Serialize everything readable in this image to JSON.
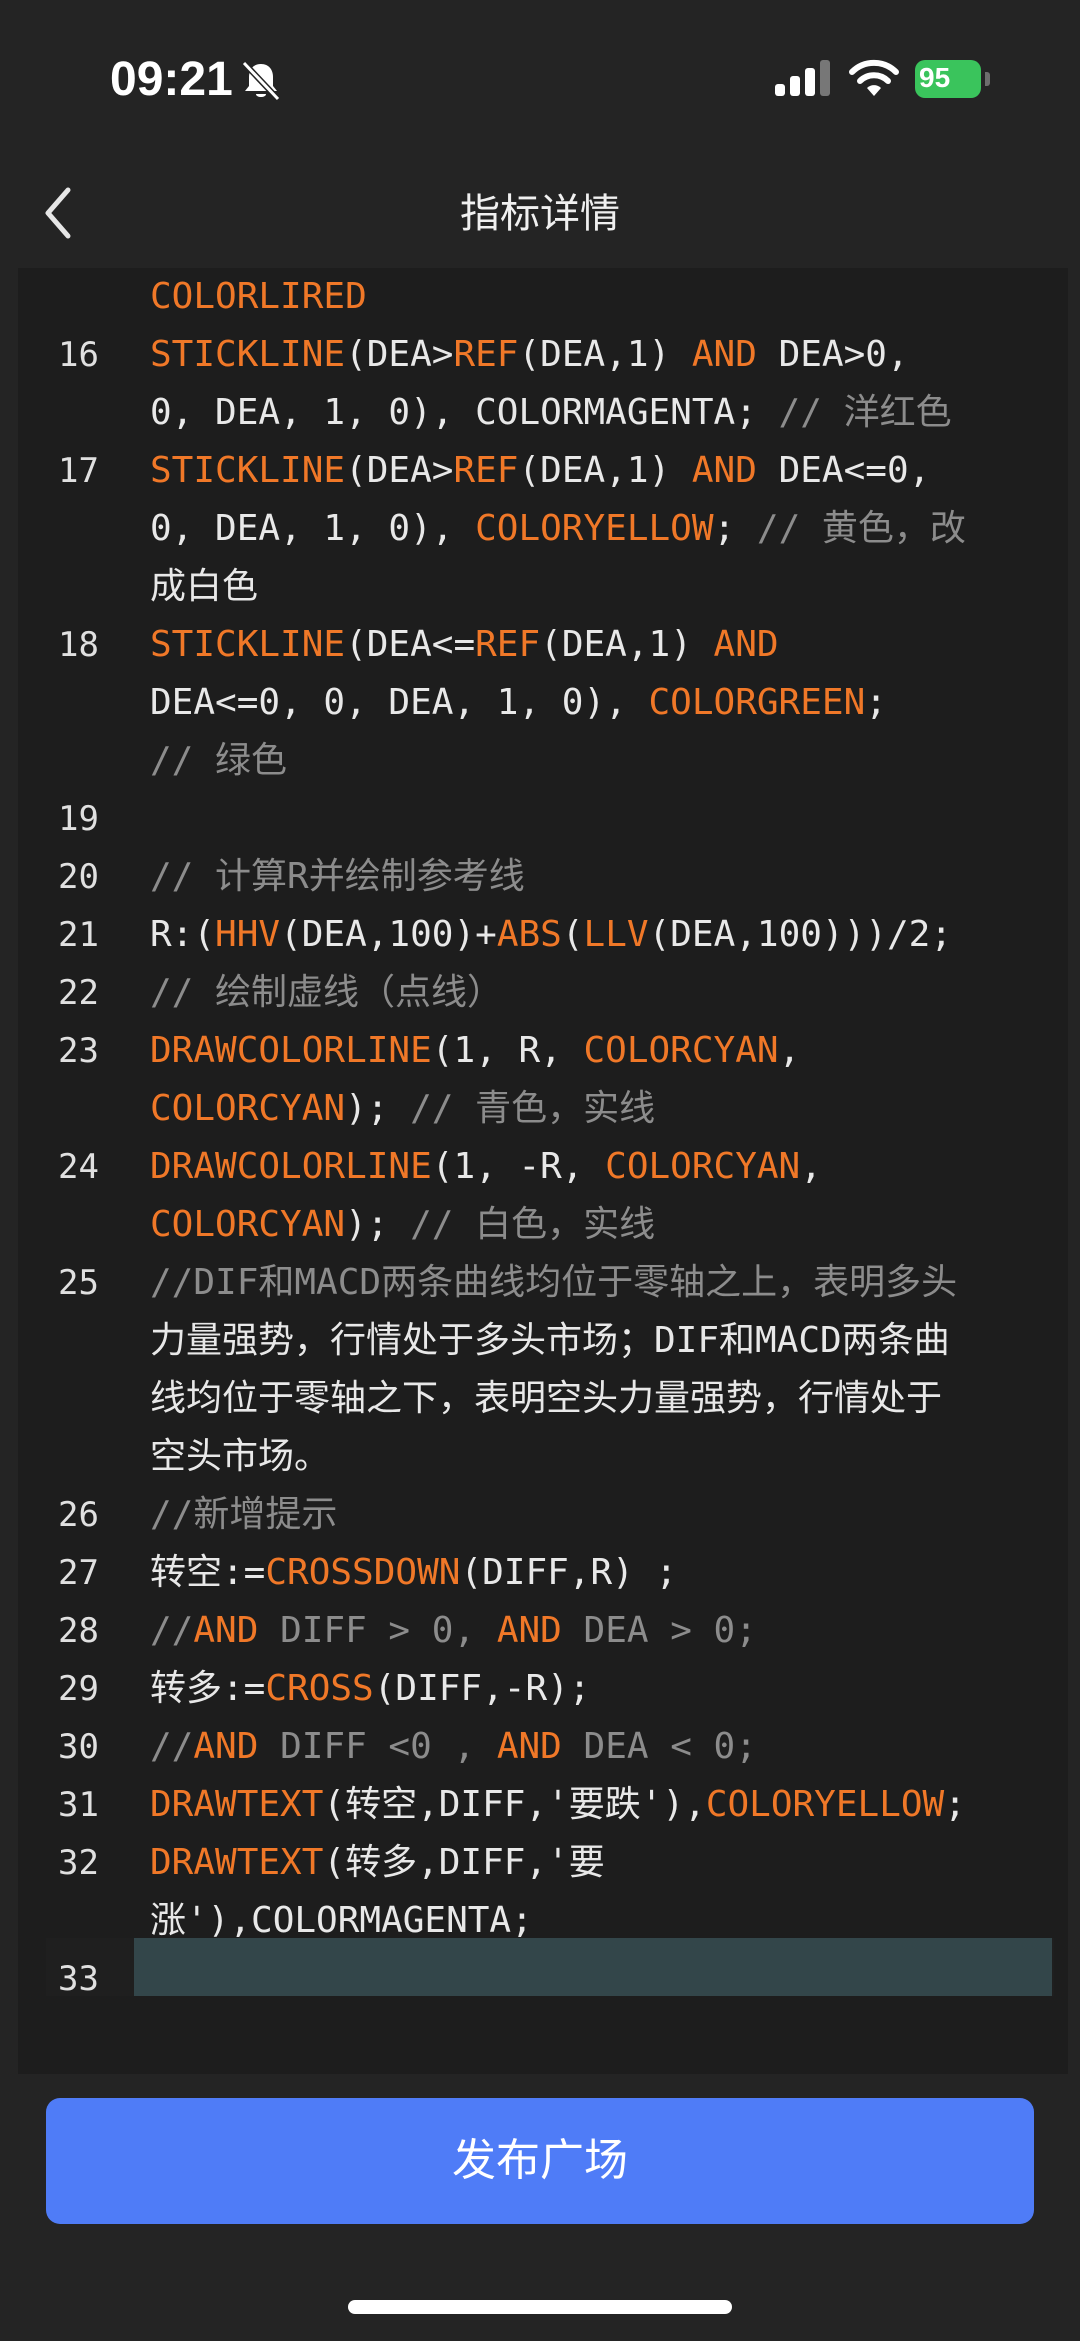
{
  "status_bar": {
    "time": "09:21",
    "battery": "95"
  },
  "nav": {
    "title": "指标详情"
  },
  "editor": {
    "lines": [
      {
        "num": "",
        "text": "COLORLIRED"
      },
      {
        "num": "16",
        "text": "STICKLINE(DEA>REF(DEA,1) AND DEA>0,"
      },
      {
        "num": "",
        "text": "0, DEA, 1, 0), COLORMAGENTA; // 洋红色"
      },
      {
        "num": "17",
        "text": "STICKLINE(DEA>REF(DEA,1) AND DEA<=0,"
      },
      {
        "num": "",
        "text": "0, DEA, 1, 0), COLORYELLOW; // 黄色，改"
      },
      {
        "num": "",
        "text": "成白色"
      },
      {
        "num": "18",
        "text": "STICKLINE(DEA<=REF(DEA,1) AND"
      },
      {
        "num": "",
        "text": "DEA<=0, 0, DEA, 1, 0), COLORGREEN;"
      },
      {
        "num": "",
        "text": "// 绿色"
      },
      {
        "num": "19",
        "text": ""
      },
      {
        "num": "20",
        "text": "// 计算R并绘制参考线"
      },
      {
        "num": "21",
        "text": "R:(HHV(DEA,100)+ABS(LLV(DEA,100)))/2;"
      },
      {
        "num": "22",
        "text": "// 绘制虚线（点线）"
      },
      {
        "num": "23",
        "text": "DRAWCOLORLINE(1, R, COLORCYAN,"
      },
      {
        "num": "",
        "text": "COLORCYAN); // 青色，实线"
      },
      {
        "num": "24",
        "text": "DRAWCOLORLINE(1, -R, COLORCYAN,"
      },
      {
        "num": "",
        "text": "COLORCYAN); // 白色，实线"
      },
      {
        "num": "25",
        "text": "//DIF和MACD两条曲线均位于零轴之上，表明多头"
      },
      {
        "num": "",
        "text": "力量强势，行情处于多头市场；DIF和MACD两条曲"
      },
      {
        "num": "",
        "text": "线均位于零轴之下，表明空头力量强势，行情处于"
      },
      {
        "num": "",
        "text": "空头市场。"
      },
      {
        "num": "26",
        "text": "//新增提示"
      },
      {
        "num": "27",
        "text": "转空:=CROSSDOWN(DIFF,R) ;"
      },
      {
        "num": "28",
        "text": "//AND DIFF > 0, AND DEA > 0;"
      },
      {
        "num": "29",
        "text": "转多:=CROSS(DIFF,-R);"
      },
      {
        "num": "30",
        "text": "//AND DIFF <0 , AND DEA < 0;"
      },
      {
        "num": "31",
        "text": "DRAWTEXT(转空,DIFF,'要跌'),COLORYELLOW;"
      },
      {
        "num": "32",
        "text": "DRAWTEXT(转多,DIFF,'要"
      },
      {
        "num": "",
        "text": "涨'),COLORMAGENTA;"
      },
      {
        "num": "33",
        "text": ""
      }
    ]
  },
  "footer": {
    "publish_label": "发布广场"
  },
  "colors": {
    "keyword": "#f07828",
    "comment": "#8c8c8c",
    "accent": "#4f7cf7",
    "battery": "#3ac45c"
  }
}
